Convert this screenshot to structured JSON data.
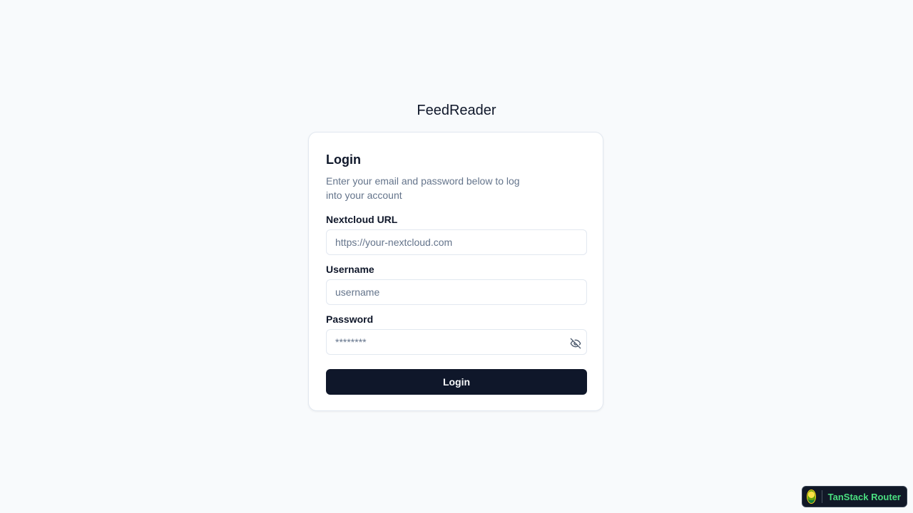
{
  "app": {
    "title": "FeedReader"
  },
  "login_card": {
    "title": "Login",
    "description": "Enter your email and password below to log into your account",
    "fields": {
      "url": {
        "label": "Nextcloud URL",
        "placeholder": "https://your-nextcloud.com",
        "value": ""
      },
      "username": {
        "label": "Username",
        "placeholder": "username",
        "value": ""
      },
      "password": {
        "label": "Password",
        "placeholder": "********",
        "value": "",
        "toggle_icon": "eye-off-icon"
      }
    },
    "submit_label": "Login"
  },
  "devtools": {
    "label": "TanStack Router",
    "logo_icon": "tanstack-logo-icon"
  },
  "colors": {
    "background": "#f8fafc",
    "primary_button": "#0f172a",
    "muted_text": "#64748b",
    "devtools_accent": "#4ade80"
  }
}
